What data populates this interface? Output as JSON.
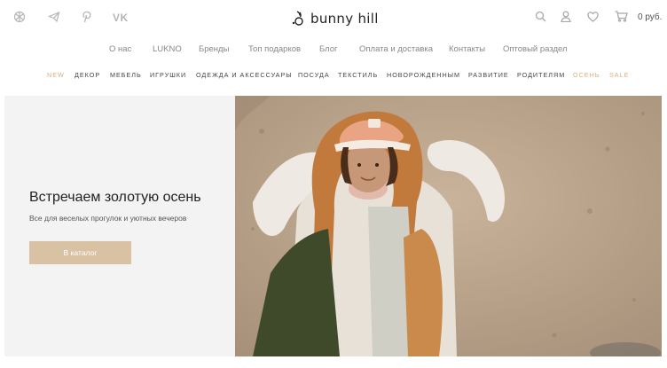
{
  "social": {
    "vk_label": "VK"
  },
  "logo": {
    "text": "bunny hill"
  },
  "cart": {
    "total": "0 руб."
  },
  "main_nav": [
    {
      "label": "О нас"
    },
    {
      "label": "LUKNO"
    },
    {
      "label": "Бренды"
    },
    {
      "label": "Топ подарков"
    },
    {
      "label": "Блог"
    },
    {
      "label": "Оплата и доставка"
    },
    {
      "label": "Контакты"
    },
    {
      "label": "Оптовый раздел"
    }
  ],
  "category_nav": [
    {
      "label": "NEW",
      "accent": true
    },
    {
      "label": "ДЕКОР",
      "accent": false
    },
    {
      "label": "МЕБЕЛЬ",
      "accent": false
    },
    {
      "label": "ИГРУШКИ",
      "accent": false
    },
    {
      "label": "ОДЕЖДА И АКСЕССУАРЫ",
      "accent": false
    },
    {
      "label": "ПОСУДА",
      "accent": false
    },
    {
      "label": "ТЕКСТИЛЬ",
      "accent": false
    },
    {
      "label": "НОВОРОЖДЕННЫМ",
      "accent": false
    },
    {
      "label": "РАЗВИТИЕ",
      "accent": false
    },
    {
      "label": "РОДИТЕЛЯМ",
      "accent": false
    },
    {
      "label": "ОСЕНЬ",
      "accent": true
    },
    {
      "label": "SALE",
      "accent": true
    }
  ],
  "hero": {
    "title": "Встречаем золотую осень",
    "subtitle": "Все для веселых прогулок и уютных вечеров",
    "button_label": "В каталог"
  },
  "colors": {
    "accent": "#d8b07e",
    "button": "#d9c2a3",
    "hero_panel": "#f3f3f3",
    "icon_gray": "#b5b5b5"
  }
}
